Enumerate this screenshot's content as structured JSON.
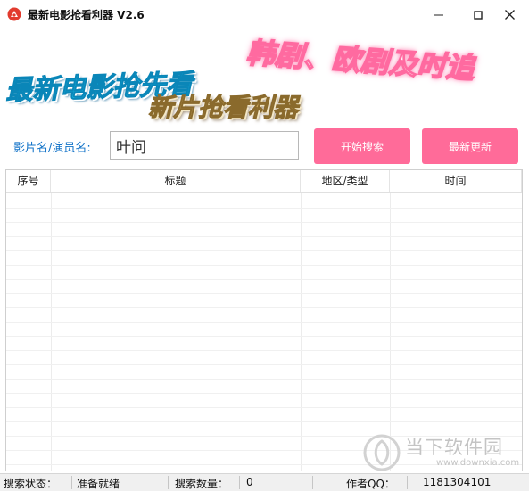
{
  "window": {
    "title": "最新电影抢看利器 V2.6",
    "icon": "red-app-icon",
    "controls": [
      "minimize-icon",
      "maximize-icon",
      "close-icon"
    ]
  },
  "banner": {
    "line1": "最新电影抢先看",
    "line2": "韩剧、欧剧及时追",
    "line3": "新片抢看利器"
  },
  "search": {
    "label": "影片名/演员名:",
    "value": "叶问",
    "search_button": "开始搜索",
    "update_button": "最新更新"
  },
  "table": {
    "columns": [
      "序号",
      "标题",
      "地区/类型",
      "时间"
    ],
    "rows": []
  },
  "status": {
    "state_label": "搜索状态：",
    "state_value": "准备就绪",
    "count_label": "搜索数量：",
    "count_value": "0",
    "author_label": "作者QQ：",
    "author_value": "1181304101"
  },
  "watermark": {
    "name": "当下软件园",
    "url": "www.downxia.com"
  },
  "colors": {
    "accent_pink": "#ff6b99",
    "label_blue": "#1273c8",
    "banner_blue": "#11b9e6",
    "banner_gold": "#c9a35c"
  }
}
